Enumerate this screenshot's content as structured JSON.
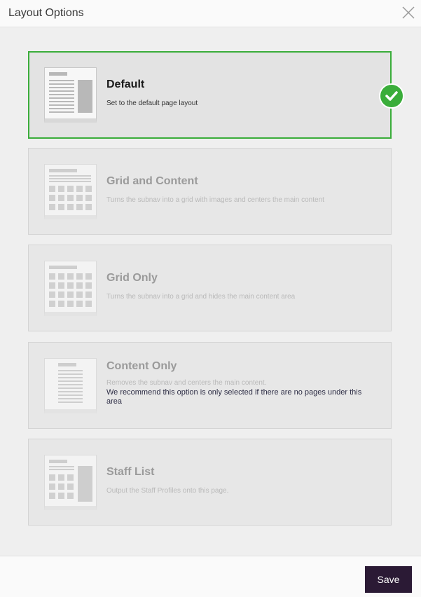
{
  "dialog": {
    "title": "Layout Options",
    "close_icon": "close-icon",
    "save_label": "Save"
  },
  "options": [
    {
      "title": "Default",
      "description": "Set to the default page layout",
      "selected": true,
      "thumbnail": "default-layout-thumbnail"
    },
    {
      "title": "Grid and Content",
      "description": "Turns the subnav into a grid with images and centers the main content",
      "selected": false,
      "thumbnail": "grid-and-content-thumbnail"
    },
    {
      "title": "Grid Only",
      "description": "Turns the subnav into a grid and hides the main content area",
      "selected": false,
      "thumbnail": "grid-only-thumbnail"
    },
    {
      "title": "Content Only",
      "description": "Removes the subnav and centers the main content.",
      "note": "We recommend this option is only selected if there are no pages under this area",
      "selected": false,
      "thumbnail": "content-only-thumbnail"
    },
    {
      "title": "Staff List",
      "description": "Output the Staff Profiles onto this page.",
      "selected": false,
      "thumbnail": "staff-list-thumbnail"
    }
  ],
  "colors": {
    "selected_border": "#3aad3a",
    "save_button": "#2b1a35"
  }
}
